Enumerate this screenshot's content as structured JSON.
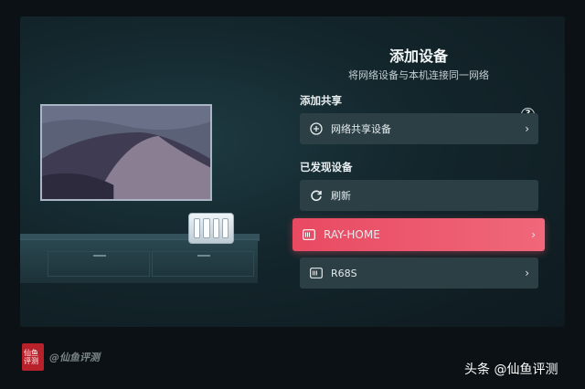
{
  "header": {
    "title": "添加设备",
    "subtitle": "将网络设备与本机连接同一网络"
  },
  "add_share": {
    "label": "添加共享",
    "help_icon": "?",
    "item": {
      "icon": "plus-circle-icon",
      "label": "网络共享设备"
    }
  },
  "discovered": {
    "label": "已发现设备",
    "refresh": {
      "icon": "refresh-icon",
      "label": "刷新"
    },
    "devices": [
      {
        "icon": "nas-device-icon",
        "label": "RAY-HOME",
        "selected": true
      },
      {
        "icon": "nas-device-icon",
        "label": "R68S",
        "selected": false
      }
    ]
  },
  "chevron": "›",
  "watermarks": {
    "left_text": "@仙鱼评测",
    "seal_text": "仙鱼评测",
    "right_text": "头条 @仙鱼评测"
  },
  "colors": {
    "accent": "#ee5a6e",
    "row_bg": "#2c3f45",
    "background": "#13262c"
  }
}
